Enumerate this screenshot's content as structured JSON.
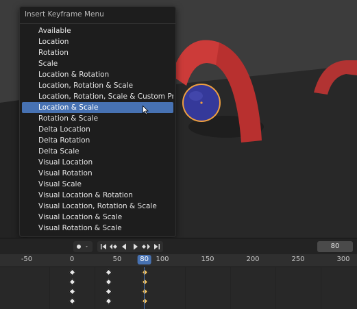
{
  "menu": {
    "title": "Insert Keyframe Menu",
    "items": [
      "Available",
      "Location",
      "Rotation",
      "Scale",
      "Location & Rotation",
      "Location, Rotation & Scale",
      "Location, Rotation, Scale & Custom Properties",
      "Location & Scale",
      "Rotation & Scale",
      "Delta Location",
      "Delta Rotation",
      "Delta Scale",
      "Visual Location",
      "Visual Rotation",
      "Visual Scale",
      "Visual Location & Rotation",
      "Visual Location, Rotation & Scale",
      "Visual Location & Scale",
      "Visual Rotation & Scale"
    ],
    "selected_index": 7
  },
  "timeline": {
    "current_frame": "80",
    "frame_field_value": "80",
    "ruler_labels": [
      "-50",
      "0",
      "50",
      "100",
      "150",
      "200",
      "250",
      "300"
    ],
    "keyframe_frames": [
      0,
      40,
      80
    ],
    "channel_rows": 4
  },
  "colors": {
    "accent": "#4772b3",
    "arch": "#b8302f",
    "sphere": "#3a3f9e",
    "sphere_outline": "#f0a040",
    "keyframe_white": "#e8e8e8",
    "keyframe_selected": "#f0c060"
  },
  "icons": {
    "record": "record-icon",
    "jump_start": "jump-start-icon",
    "prev_keyframe": "prev-keyframe-icon",
    "play_reverse": "play-reverse-icon",
    "play": "play-icon",
    "next_keyframe": "next-keyframe-icon",
    "jump_end": "jump-end-icon"
  }
}
